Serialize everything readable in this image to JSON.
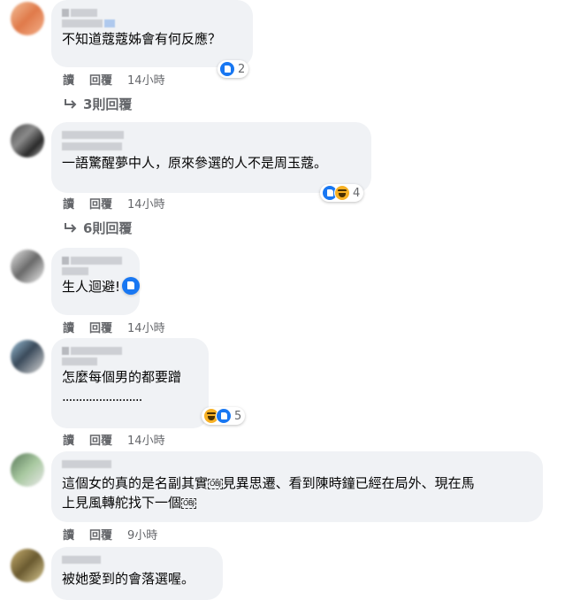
{
  "actions": {
    "read": "讀",
    "reply": "回覆"
  },
  "obj_glyph": "OBJ",
  "comments": [
    {
      "text": "不知道蔻蔻姊會有何反應？",
      "time": "14小時",
      "reaction_count": "2",
      "replies": "3則回覆"
    },
    {
      "text": "一語驚醒夢中人，原來參選的人不是周玉蔻。",
      "time": "14小時",
      "reaction_count": "4",
      "replies": "6則回覆"
    },
    {
      "text": "生人迴避!",
      "time": "14小時"
    },
    {
      "text": "怎麼每個男的都要蹭",
      "text2": "........................",
      "time": "14小時",
      "reaction_count": "5"
    },
    {
      "text_a": "這個女的真的是名副其實",
      "text_b": "見異思遷、看到陳時鐘已經在局外、現在馬",
      "text_c": "上見風轉舵找下一個",
      "time": "9小時"
    },
    {
      "text": "被她愛到的會落選喔。"
    }
  ]
}
